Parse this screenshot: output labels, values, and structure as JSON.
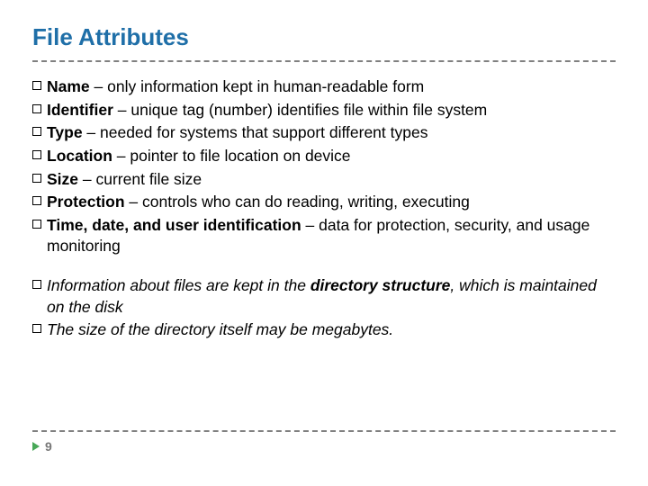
{
  "title": "File Attributes",
  "attrs": {
    "name": {
      "term": "Name",
      "desc": " – only information kept in human-readable form"
    },
    "identifier": {
      "term": "Identifier",
      "desc": " – unique tag (number) identifies file within file system"
    },
    "type": {
      "term": "Type",
      "desc": " – needed for systems that support different types"
    },
    "location": {
      "term": "Location",
      "desc": " – pointer to file location on device"
    },
    "size": {
      "term": "Size",
      "desc": " – current file size"
    },
    "protection": {
      "term": "Protection",
      "desc": " – controls who can do reading, writing, executing"
    },
    "time": {
      "term": "Time, date, and user identification",
      "desc": " – data for protection, security, and usage monitoring"
    }
  },
  "notes": {
    "dir": {
      "pre": "Information about files are kept in the ",
      "bold": "directory structure",
      "post": ", which is maintained on the disk"
    },
    "size": "The size of the directory itself may be megabytes."
  },
  "page": "9"
}
